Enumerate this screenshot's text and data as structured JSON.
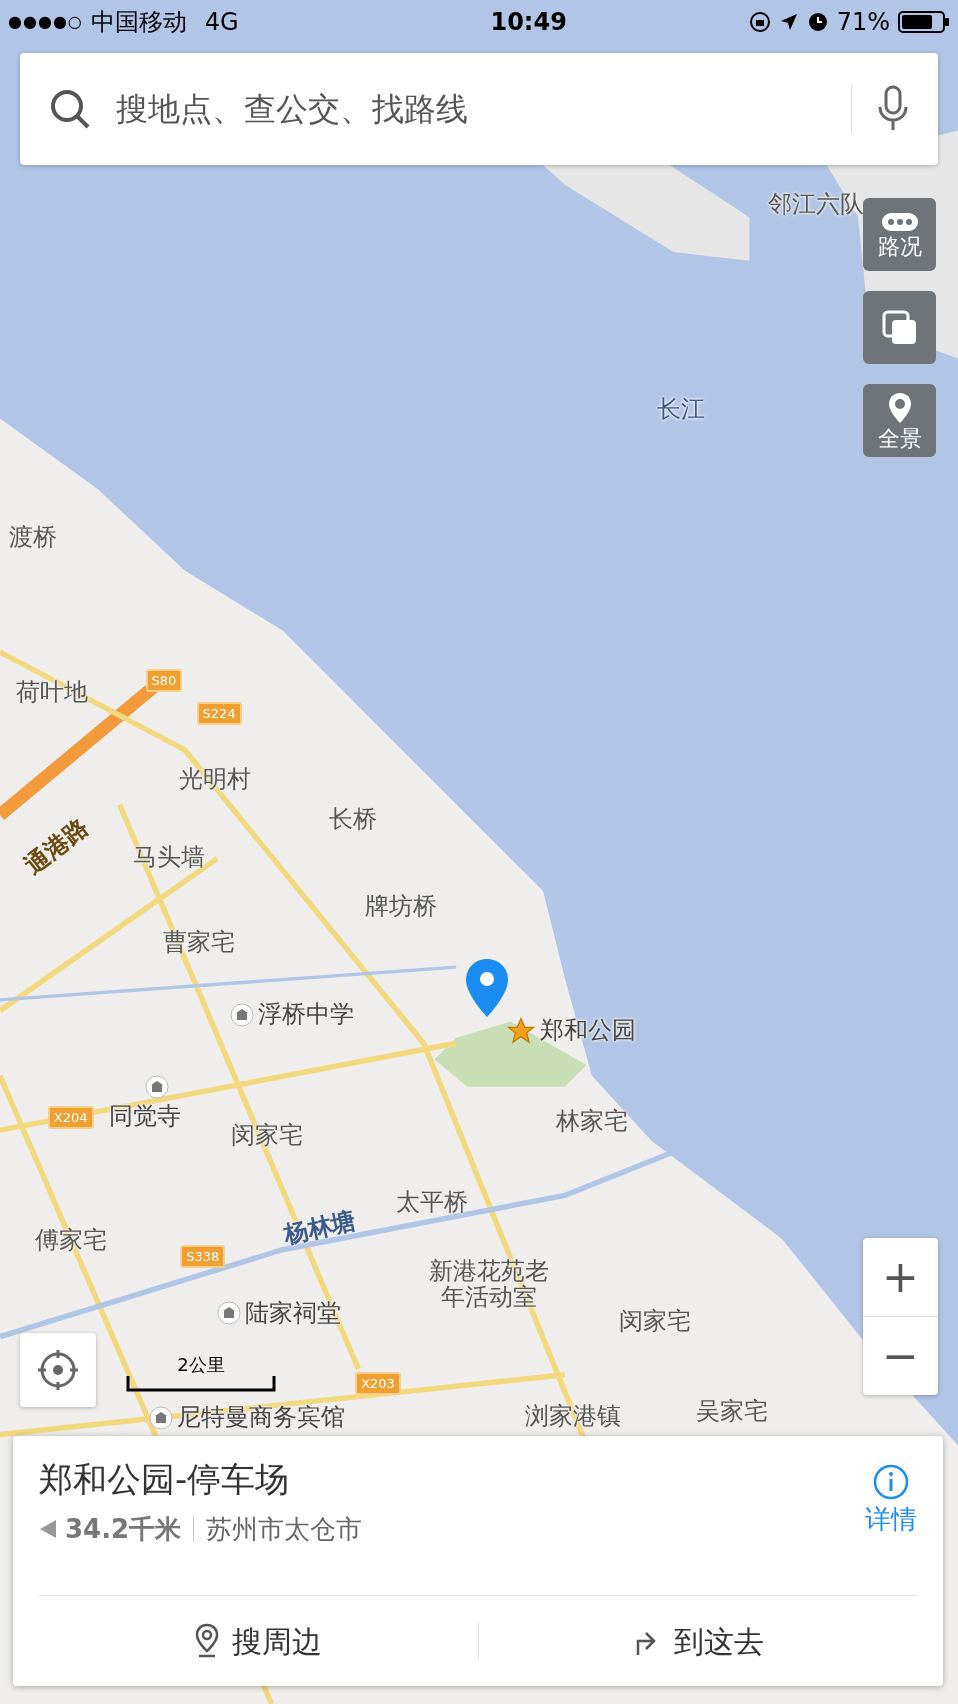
{
  "status_bar": {
    "signal": "●●●●○",
    "carrier": "中国移动",
    "network": "4G",
    "time": "10:49",
    "battery": "71%"
  },
  "search": {
    "placeholder": "搜地点、查公交、找路线"
  },
  "map_buttons": [
    {
      "kind": "traffic",
      "label": "路况"
    },
    {
      "kind": "layers"
    },
    {
      "kind": "panorama",
      "label": "全景"
    }
  ],
  "map_labels": [
    {
      "kind": "water",
      "text": "长江"
    },
    {
      "kind": "place",
      "text": "邻江六队"
    },
    {
      "kind": "place",
      "text": "渡桥"
    },
    {
      "kind": "place",
      "text": "荷叶地"
    },
    {
      "kind": "place",
      "text": "光明村"
    },
    {
      "kind": "place",
      "text": "长桥"
    },
    {
      "kind": "place",
      "text": "马头墙"
    },
    {
      "kind": "road",
      "text": "通港路"
    },
    {
      "kind": "place",
      "text": "牌坊桥"
    },
    {
      "kind": "place",
      "text": "曹家宅"
    },
    {
      "kind": "school",
      "text": "浮桥中学"
    },
    {
      "kind": "park",
      "text": "郑和公园"
    },
    {
      "kind": "temple",
      "text": "同觉寺"
    },
    {
      "kind": "place",
      "text": "闵家宅"
    },
    {
      "kind": "place",
      "text": "林家宅"
    },
    {
      "kind": "place",
      "text": "太平桥"
    },
    {
      "kind": "river",
      "text": "杨林塘"
    },
    {
      "kind": "place",
      "text": "傅家宅"
    },
    {
      "kind": "place",
      "text": "新港花苑老年活动室"
    },
    {
      "kind": "temple",
      "text": "陆家祠堂"
    },
    {
      "kind": "place",
      "text": "闵家宅"
    },
    {
      "kind": "hotel",
      "text": "尼特曼商务宾馆"
    },
    {
      "kind": "place",
      "text": "浏家港镇"
    },
    {
      "kind": "place",
      "text": "吴家宅"
    },
    {
      "kind": "shield",
      "text": "S80"
    },
    {
      "kind": "shield",
      "text": "S224"
    },
    {
      "kind": "shield",
      "text": "X204"
    },
    {
      "kind": "shield",
      "text": "S338"
    },
    {
      "kind": "shield",
      "text": "X203"
    }
  ],
  "scale": "2公里",
  "zoom": {
    "plus": "+",
    "minus": "−"
  },
  "place_card": {
    "title": "郑和公园-停车场",
    "distance": "34.2千米",
    "region": "苏州市太仓市",
    "details": "详情",
    "actions": [
      {
        "kind": "nearby",
        "label": "搜周边"
      },
      {
        "kind": "route",
        "label": "到这去"
      }
    ]
  }
}
